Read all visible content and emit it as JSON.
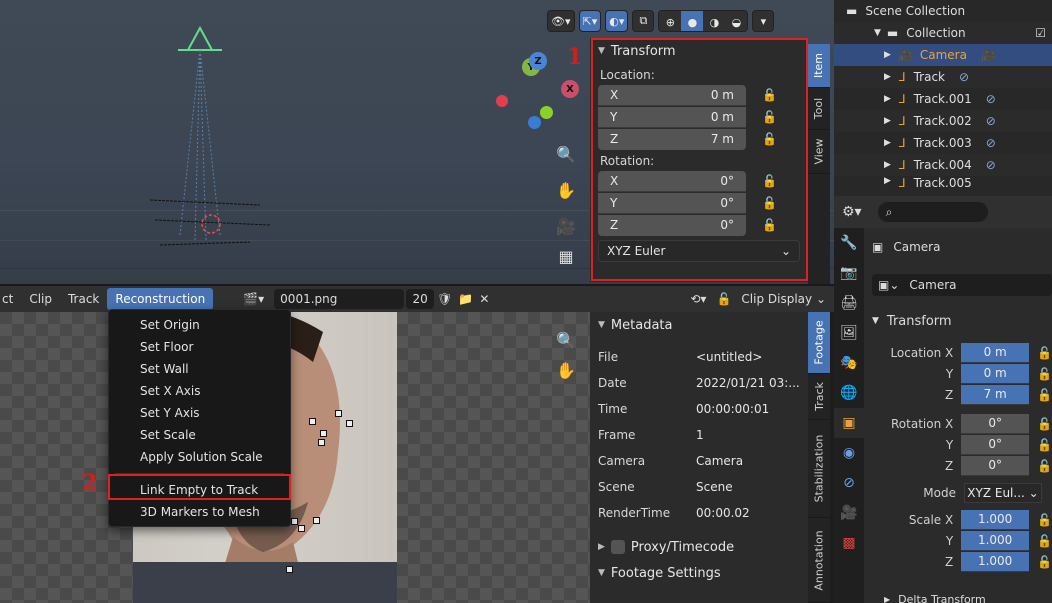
{
  "annotations": {
    "n1": "1",
    "n2": "2"
  },
  "viewport": {
    "gizmo": {
      "y": "Y",
      "z": "Z",
      "x": "X"
    },
    "transform_panel": {
      "title": "Transform",
      "location_label": "Location:",
      "location": [
        {
          "axis": "X",
          "value": "0 m"
        },
        {
          "axis": "Y",
          "value": "0 m"
        },
        {
          "axis": "Z",
          "value": "7 m"
        }
      ],
      "rotation_label": "Rotation:",
      "rotation": [
        {
          "axis": "X",
          "value": "0°"
        },
        {
          "axis": "Y",
          "value": "0°"
        },
        {
          "axis": "Z",
          "value": "0°"
        }
      ],
      "rotation_mode": "XYZ Euler"
    },
    "side_tabs": [
      "Item",
      "Tool",
      "View"
    ]
  },
  "clip_editor": {
    "menus": [
      "ct",
      "Clip",
      "Track",
      "Reconstruction"
    ],
    "clip_name": "0001.png",
    "users": "20",
    "display_menu": "Clip Display",
    "reconstruction_menu": {
      "group1": [
        "Set Origin",
        "Set Floor",
        "Set Wall",
        "Set X Axis",
        "Set Y Axis",
        "Set Scale",
        "Apply Solution Scale"
      ],
      "group2": [
        "Link Empty to Track",
        "3D Markers to Mesh"
      ]
    },
    "metadata_panel": {
      "title": "Metadata",
      "rows": [
        {
          "k": "File",
          "v": "<untitled>"
        },
        {
          "k": "Date",
          "v": "2022/01/21 03:..."
        },
        {
          "k": "Time",
          "v": "00:00:00:01"
        },
        {
          "k": "Frame",
          "v": "1"
        },
        {
          "k": "Camera",
          "v": "Camera"
        },
        {
          "k": "Scene",
          "v": "Scene"
        },
        {
          "k": "RenderTime",
          "v": "00:00.02"
        }
      ],
      "proxy": "Proxy/Timecode",
      "footage_settings": "Footage Settings"
    },
    "side_tabs": [
      "Footage",
      "Track",
      "Stabilization",
      "Annotation"
    ]
  },
  "outliner": {
    "scene_collection": "Scene Collection",
    "collection": "Collection",
    "items": [
      "Camera",
      "Track",
      "Track.001",
      "Track.002",
      "Track.003",
      "Track.004",
      "Track.005"
    ]
  },
  "properties": {
    "object_name": "Camera",
    "data_name": "Camera",
    "transform_title": "Transform",
    "location": [
      {
        "label": "Location X",
        "value": "0 m"
      },
      {
        "label": "Y",
        "value": "0 m"
      },
      {
        "label": "Z",
        "value": "7 m"
      }
    ],
    "rotation": [
      {
        "label": "Rotation X",
        "value": "0°"
      },
      {
        "label": "Y",
        "value": "0°"
      },
      {
        "label": "Z",
        "value": "0°"
      }
    ],
    "mode_label": "Mode",
    "mode_value": "XYZ Eul...",
    "scale": [
      {
        "label": "Scale X",
        "value": "1.000"
      },
      {
        "label": "Y",
        "value": "1.000"
      },
      {
        "label": "Z",
        "value": "1.000"
      }
    ],
    "delta_transform": "Delta Transform"
  },
  "colors": {
    "accent": "#4772b3",
    "annotation_red": "#e02020",
    "camera_orange": "#e8a33a"
  }
}
